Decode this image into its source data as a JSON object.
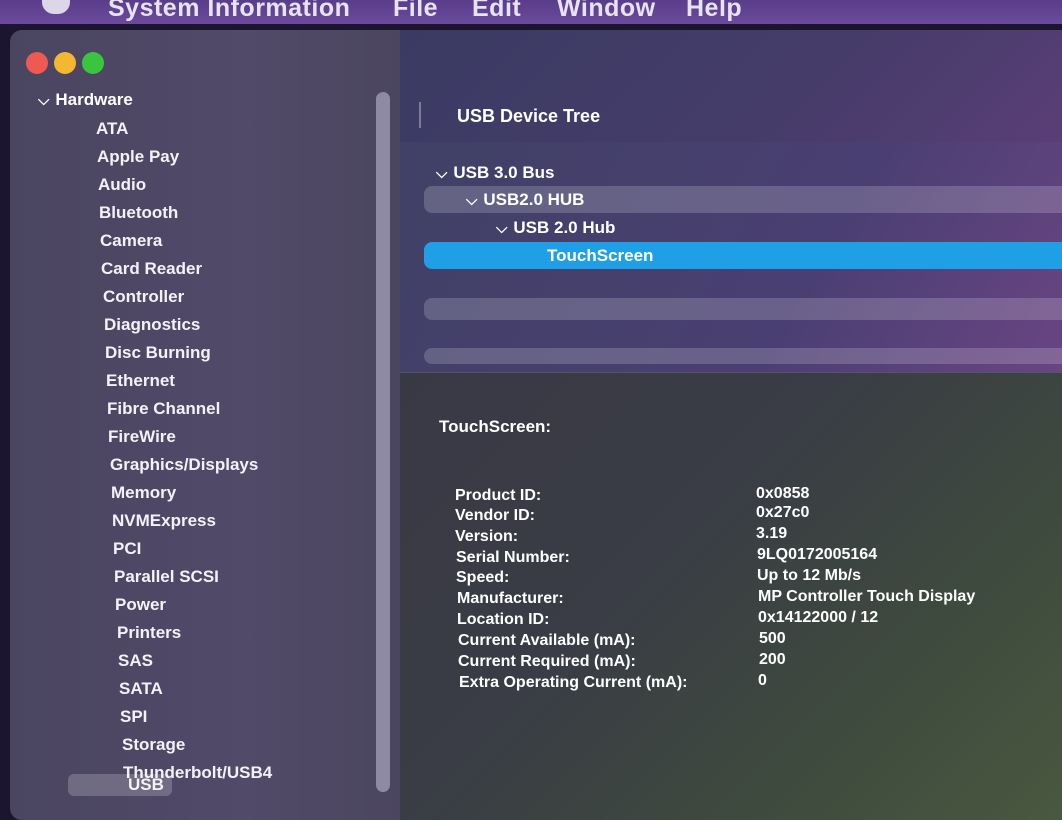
{
  "menubar": {
    "app_name": "System Information",
    "items": [
      "File",
      "Edit",
      "Window",
      "Help"
    ]
  },
  "sidebar": {
    "section": "Hardware",
    "items": [
      "ATA",
      "Apple Pay",
      "Audio",
      "Bluetooth",
      "Camera",
      "Card Reader",
      "Controller",
      "Diagnostics",
      "Disc Burning",
      "Ethernet",
      "Fibre Channel",
      "FireWire",
      "Graphics/Displays",
      "Memory",
      "NVMExpress",
      "PCI",
      "Parallel SCSI",
      "Power",
      "Printers",
      "SAS",
      "SATA",
      "SPI",
      "Storage",
      "Thunderbolt/USB4",
      "USB"
    ],
    "selected": "USB"
  },
  "toolbar": {
    "title": "USB Device Tree"
  },
  "tree": {
    "rows": [
      {
        "label": "USB 3.0 Bus",
        "expanded": true
      },
      {
        "label": "USB2.0 HUB",
        "expanded": true
      },
      {
        "label": "USB 2.0 Hub",
        "expanded": true
      },
      {
        "label": "TouchScreen",
        "selected": true
      }
    ]
  },
  "detail": {
    "heading": "TouchScreen:",
    "properties": [
      {
        "label": "Product ID:",
        "value": "0x0858"
      },
      {
        "label": "Vendor ID:",
        "value": "0x27c0"
      },
      {
        "label": "Version:",
        "value": "3.19"
      },
      {
        "label": "Serial Number:",
        "value": "9LQ0172005164"
      },
      {
        "label": "Speed:",
        "value": "Up to 12 Mb/s"
      },
      {
        "label": "Manufacturer:",
        "value": "MP Controller Touch Display"
      },
      {
        "label": "Location ID:",
        "value": "0x14122000 / 12"
      },
      {
        "label": "Current Available (mA):",
        "value": "500"
      },
      {
        "label": "Current Required (mA):",
        "value": "200"
      },
      {
        "label": "Extra Operating Current (mA):",
        "value": "0"
      }
    ]
  },
  "colors": {
    "selection": "#1fa0e6",
    "close": "#ee5a52",
    "minimize": "#f3b830",
    "zoom": "#3ac53f"
  }
}
